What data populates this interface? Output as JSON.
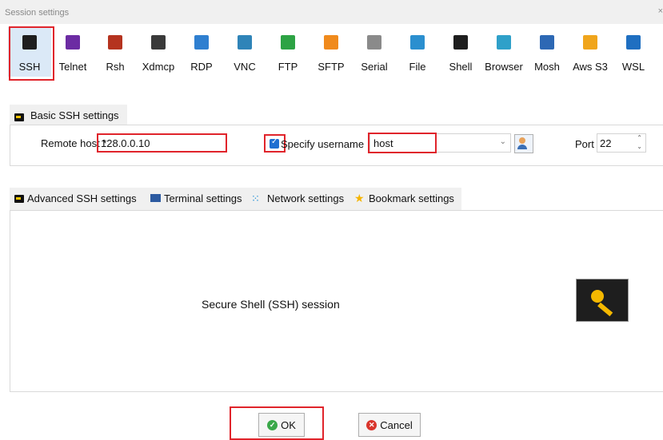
{
  "window": {
    "title": "Session settings"
  },
  "protocols": [
    {
      "label": "SSH",
      "icon": "ssh-icon",
      "color": "#1e1e1e",
      "selected": true
    },
    {
      "label": "Telnet",
      "icon": "telnet-icon",
      "color": "#6c2ca3"
    },
    {
      "label": "Rsh",
      "icon": "rsh-icon",
      "color": "#b5331f"
    },
    {
      "label": "Xdmcp",
      "icon": "xdmcp-icon",
      "color": "#3a3a3a"
    },
    {
      "label": "RDP",
      "icon": "rdp-icon",
      "color": "#2f7fd0"
    },
    {
      "label": "VNC",
      "icon": "vnc-icon",
      "color": "#2f84b8"
    },
    {
      "label": "FTP",
      "icon": "ftp-icon",
      "color": "#2da344"
    },
    {
      "label": "SFTP",
      "icon": "sftp-icon",
      "color": "#f08a1c"
    },
    {
      "label": "Serial",
      "icon": "serial-icon",
      "color": "#8a8a8a"
    },
    {
      "label": "File",
      "icon": "file-icon",
      "color": "#2b8fcf"
    },
    {
      "label": "Shell",
      "icon": "shell-icon",
      "color": "#1e1e1e"
    },
    {
      "label": "Browser",
      "icon": "browser-icon",
      "color": "#2fa0c9"
    },
    {
      "label": "Mosh",
      "icon": "mosh-icon",
      "color": "#2d68b4"
    },
    {
      "label": "Aws S3",
      "icon": "aws-s3-icon",
      "color": "#f0a51c"
    },
    {
      "label": "WSL",
      "icon": "wsl-icon",
      "color": "#1f6fc1"
    }
  ],
  "basic": {
    "tab_label": "Basic SSH settings",
    "remote_host_label": "Remote host *",
    "remote_host_value": "128.0.0.10",
    "specify_username_label": "Specify username",
    "specify_username_checked": true,
    "username_value": "host",
    "port_label": "Port",
    "port_value": "22"
  },
  "tabs": [
    {
      "label": "Advanced SSH settings",
      "icon": "ssh-key-icon"
    },
    {
      "label": "Terminal settings",
      "icon": "terminal-icon"
    },
    {
      "label": "Network settings",
      "icon": "network-icon"
    },
    {
      "label": "Bookmark settings",
      "icon": "star-icon"
    }
  ],
  "panel": {
    "description": "Secure Shell (SSH) session",
    "icon": "key-icon"
  },
  "buttons": {
    "ok": "OK",
    "cancel": "Cancel"
  },
  "colors": {
    "highlight": "#e0242b",
    "selected_bg": "#dbe9f7",
    "checkbox": "#1f6fd1",
    "ok_green": "#3aa84a",
    "cancel_red": "#d9342b"
  }
}
